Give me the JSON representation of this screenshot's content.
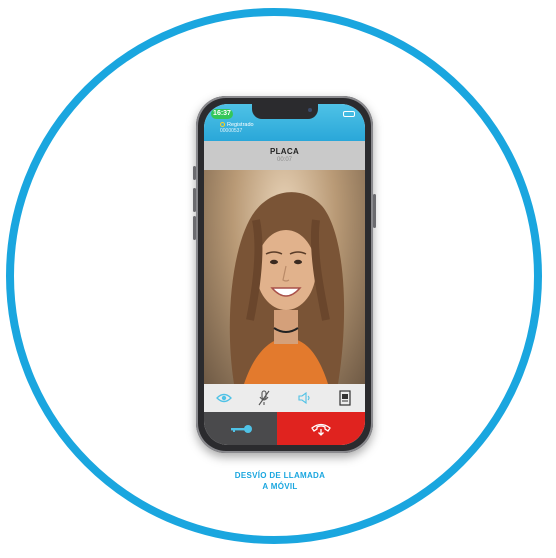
{
  "colors": {
    "ring": "#1aa6df",
    "hangup": "#e0231f",
    "status_bar": "#2aa7d9",
    "caption": "#1aa6df"
  },
  "status_bar": {
    "time": "16:37",
    "registration": "Registrado",
    "extension": "00000537"
  },
  "call": {
    "title": "PLACA",
    "duration": "00:07"
  },
  "video": {
    "description": "caller video feed"
  },
  "controls": [
    {
      "name": "eye-icon"
    },
    {
      "name": "mic-muted-icon"
    },
    {
      "name": "speaker-icon"
    },
    {
      "name": "door-panel-icon"
    }
  ],
  "actions": {
    "open_icon": "key-icon",
    "hangup_icon": "hangup-icon"
  },
  "caption": {
    "line1": "DESVÍO DE LLAMADA",
    "line2": "A MÓVIL"
  }
}
